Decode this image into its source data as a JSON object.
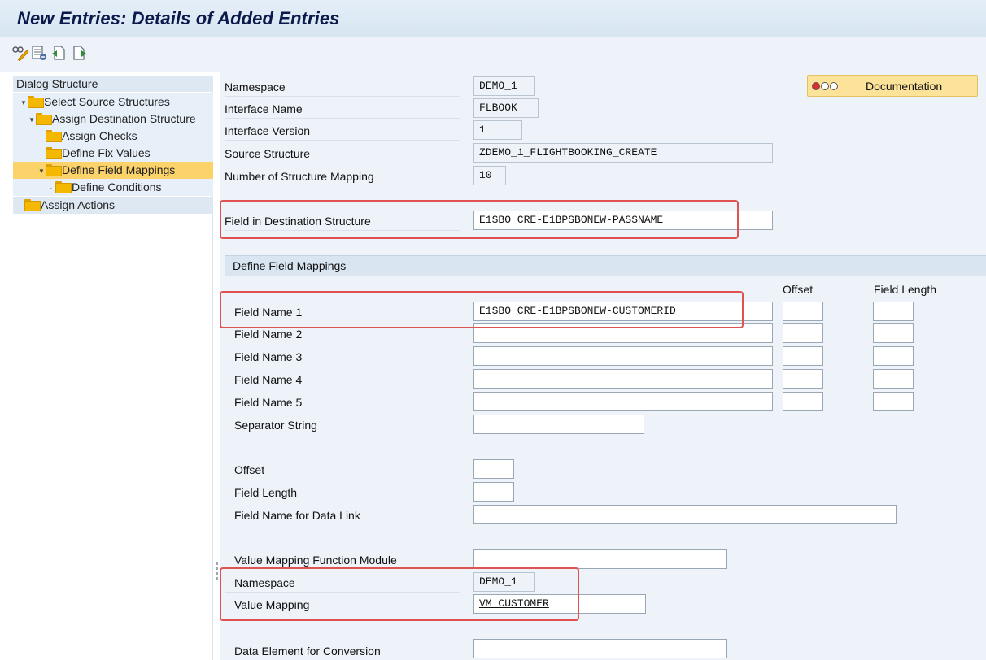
{
  "window": {
    "title": "New Entries: Details of Added Entries"
  },
  "toolbar": {
    "icons": [
      "display-change-icon",
      "delete-icon",
      "previous-entry-icon",
      "next-entry-icon"
    ]
  },
  "dialog_structure": {
    "header": "Dialog Structure",
    "items": [
      {
        "label": "Select Source Structures",
        "expanded": true
      },
      {
        "label": "Assign Destination Structure",
        "expanded": true
      },
      {
        "label": "Assign Checks",
        "expanded": false
      },
      {
        "label": "Define Fix Values",
        "expanded": false
      },
      {
        "label": "Define Field Mappings",
        "expanded": true,
        "selected": true
      },
      {
        "label": "Define Conditions",
        "expanded": false
      },
      {
        "label": "Assign Actions",
        "expanded": false
      }
    ]
  },
  "header_fields": {
    "namespace": {
      "label": "Namespace",
      "value": "DEMO_1"
    },
    "interface_name": {
      "label": "Interface Name",
      "value": "FLBOOK"
    },
    "interface_version": {
      "label": "Interface Version",
      "value": "1"
    },
    "source_structure": {
      "label": "Source Structure",
      "value": "ZDEMO_1_FLIGHTBOOKING_CREATE"
    },
    "num_structure_mapping": {
      "label": "Number of Structure Mapping",
      "value": "10"
    },
    "destination_field": {
      "label": "Field in Destination Structure",
      "value": "E1SBO_CRE-E1BPSBONEW-PASSNAME"
    }
  },
  "documentation_button": {
    "label": "Documentation"
  },
  "field_mappings": {
    "title": "Define Field Mappings",
    "col_offset": "Offset",
    "col_field_length": "Field Length",
    "field_names": [
      {
        "label": "Field Name 1",
        "value": "E1SBO_CRE-E1BPSBONEW-CUSTOMERID"
      },
      {
        "label": "Field Name 2",
        "value": ""
      },
      {
        "label": "Field Name 3",
        "value": ""
      },
      {
        "label": "Field Name 4",
        "value": ""
      },
      {
        "label": "Field Name 5",
        "value": ""
      }
    ],
    "separator": {
      "label": "Separator String",
      "value": ""
    },
    "offset": {
      "label": "Offset",
      "value": ""
    },
    "field_length": {
      "label": "Field Length",
      "value": ""
    },
    "data_link": {
      "label": "Field Name for Data Link",
      "value": ""
    },
    "value_mapping_fm": {
      "label": "Value Mapping Function Module",
      "value": ""
    },
    "vm_namespace": {
      "label": "Namespace",
      "value": "DEMO_1"
    },
    "value_mapping": {
      "label": "Value Mapping",
      "value": "VM_CUSTOMER"
    },
    "data_element": {
      "label": "Data Element for Conversion",
      "value": ""
    }
  },
  "colors": {
    "highlight_box": "#e05252",
    "selected_tree_item": "#fcd26a",
    "documentation_button": "#fde29a"
  }
}
